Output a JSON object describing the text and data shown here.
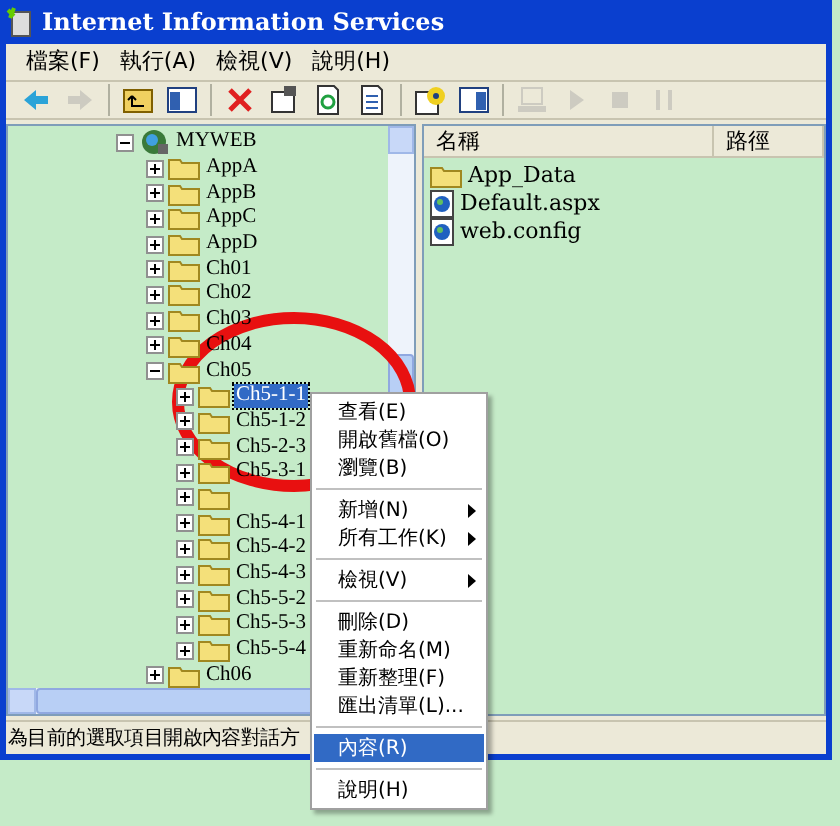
{
  "window": {
    "title": "Internet Information Services"
  },
  "menu_bar": [
    "檔案(F)",
    "執行(A)",
    "檢視(V)",
    "說明(H)"
  ],
  "toolbar": [
    {
      "kind": "back",
      "disabled": false
    },
    {
      "kind": "forward",
      "disabled": true
    },
    {
      "kind": "sep"
    },
    {
      "kind": "up",
      "disabled": false
    },
    {
      "kind": "tree",
      "disabled": false
    },
    {
      "kind": "sep"
    },
    {
      "kind": "delete",
      "disabled": false
    },
    {
      "kind": "properties",
      "disabled": false
    },
    {
      "kind": "refresh",
      "disabled": false
    },
    {
      "kind": "export",
      "disabled": false
    },
    {
      "kind": "sep"
    },
    {
      "kind": "help",
      "disabled": false
    },
    {
      "kind": "panel",
      "disabled": false
    },
    {
      "kind": "sep"
    },
    {
      "kind": "computer",
      "disabled": true
    },
    {
      "kind": "play",
      "disabled": true
    },
    {
      "kind": "stop",
      "disabled": true
    },
    {
      "kind": "pause",
      "disabled": true
    }
  ],
  "tree": [
    {
      "label": "MYWEB",
      "kind": "site",
      "expanded": true,
      "selected": false,
      "children": [
        {
          "label": "AppA",
          "kind": "folder",
          "expanded": false,
          "selected": false
        },
        {
          "label": "AppB",
          "kind": "folder",
          "expanded": false,
          "selected": false
        },
        {
          "label": "AppC",
          "kind": "folder",
          "expanded": false,
          "selected": false
        },
        {
          "label": "AppD",
          "kind": "folder",
          "expanded": false,
          "selected": false
        },
        {
          "label": "Ch01",
          "kind": "folder",
          "expanded": false,
          "selected": false
        },
        {
          "label": "Ch02",
          "kind": "folder",
          "expanded": false,
          "selected": false
        },
        {
          "label": "Ch03",
          "kind": "folder",
          "expanded": false,
          "selected": false
        },
        {
          "label": "Ch04",
          "kind": "folder",
          "expanded": false,
          "selected": false
        },
        {
          "label": "Ch05",
          "kind": "folder",
          "expanded": true,
          "selected": false,
          "children": [
            {
              "label": "Ch5-1-1",
              "kind": "folder",
              "expanded": false,
              "selected": true
            },
            {
              "label": "Ch5-1-2",
              "kind": "folder",
              "expanded": false,
              "selected": false
            },
            {
              "label": "Ch5-2-3",
              "kind": "folder",
              "expanded": false,
              "selected": false
            },
            {
              "label": "Ch5-3-1",
              "kind": "folder",
              "expanded": false,
              "selected": false
            },
            {
              "kind": "folder",
              "expanded": false,
              "selected": false
            },
            {
              "label": "Ch5-4-1",
              "kind": "folder",
              "expanded": false,
              "selected": false
            },
            {
              "label": "Ch5-4-2",
              "kind": "folder",
              "expanded": false,
              "selected": false
            },
            {
              "label": "Ch5-4-3",
              "kind": "folder",
              "expanded": false,
              "selected": false
            },
            {
              "label": "Ch5-5-2",
              "kind": "folder",
              "expanded": false,
              "selected": false
            },
            {
              "label": "Ch5-5-3",
              "kind": "folder",
              "expanded": false,
              "selected": false
            },
            {
              "label": "Ch5-5-4",
              "kind": "folder",
              "expanded": false,
              "selected": false
            }
          ]
        },
        {
          "label": "Ch06",
          "kind": "folder",
          "expanded": false,
          "selected": false
        }
      ]
    }
  ],
  "list": {
    "columns": [
      "名稱",
      "路徑"
    ],
    "items": [
      {
        "name": "App_Data",
        "kind": "folder"
      },
      {
        "name": "Default.aspx",
        "kind": "file"
      },
      {
        "name": "web.config",
        "kind": "file"
      }
    ]
  },
  "status_bar": "為目前的選取項目開啟內容對話方",
  "context_menu": [
    {
      "kind": "item",
      "label": "查看(E)",
      "submenu": false,
      "selected": false
    },
    {
      "kind": "item",
      "label": "開啟舊檔(O)",
      "submenu": false,
      "selected": false
    },
    {
      "kind": "item",
      "label": "瀏覽(B)",
      "submenu": false,
      "selected": false
    },
    {
      "kind": "sep"
    },
    {
      "kind": "item",
      "label": "新增(N)",
      "submenu": true,
      "selected": false
    },
    {
      "kind": "item",
      "label": "所有工作(K)",
      "submenu": true,
      "selected": false
    },
    {
      "kind": "sep"
    },
    {
      "kind": "item",
      "label": "檢視(V)",
      "submenu": true,
      "selected": false
    },
    {
      "kind": "sep"
    },
    {
      "kind": "item",
      "label": "刪除(D)",
      "submenu": false,
      "selected": false
    },
    {
      "kind": "item",
      "label": "重新命名(M)",
      "submenu": false,
      "selected": false
    },
    {
      "kind": "item",
      "label": "重新整理(F)",
      "submenu": false,
      "selected": false
    },
    {
      "kind": "item",
      "label": "匯出清單(L)...",
      "submenu": false,
      "selected": false
    },
    {
      "kind": "sep"
    },
    {
      "kind": "item",
      "label": "內容(R)",
      "submenu": false,
      "selected": true
    },
    {
      "kind": "sep"
    },
    {
      "kind": "item",
      "label": "說明(H)",
      "submenu": false,
      "selected": false
    }
  ]
}
